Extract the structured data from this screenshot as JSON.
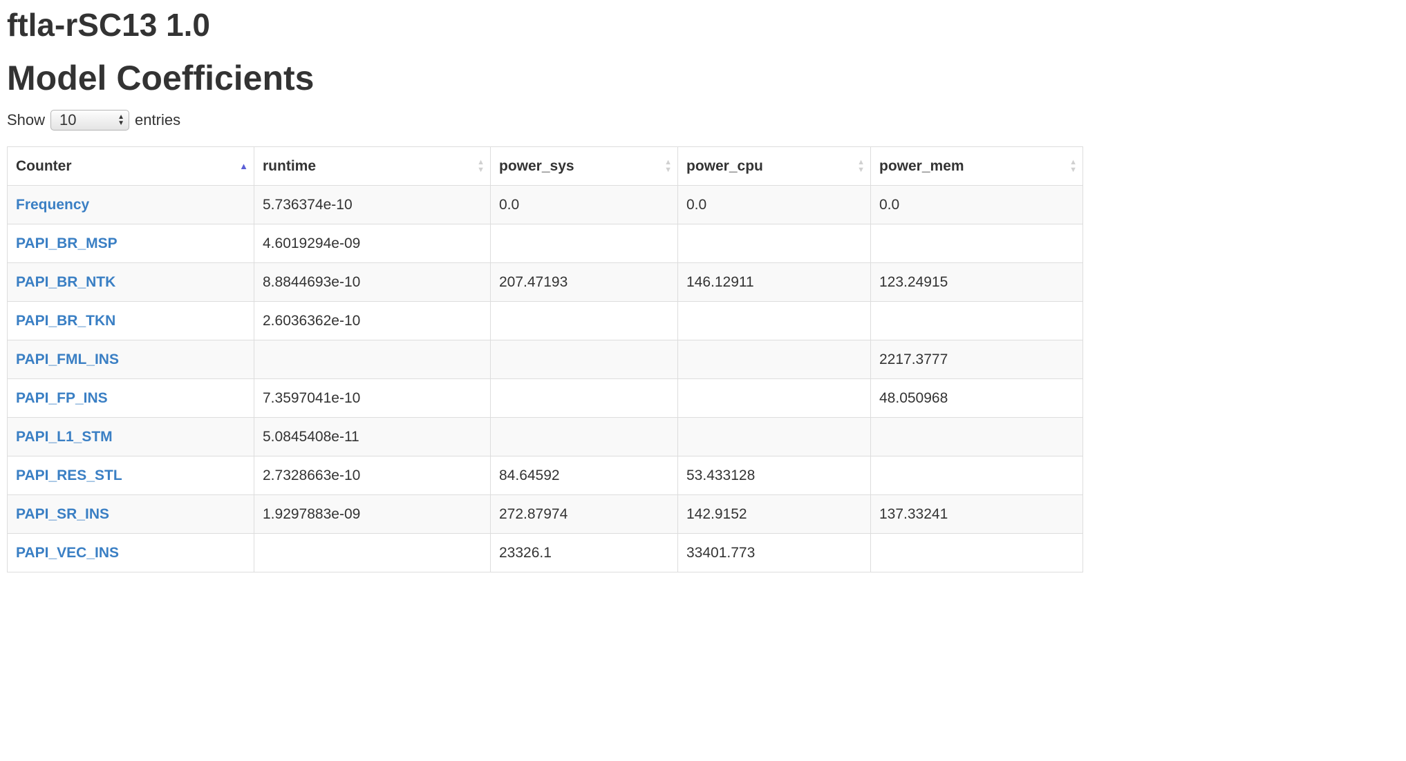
{
  "header": {
    "title": "ftla-rSC13 1.0",
    "subtitle": "Model Coefficients"
  },
  "length_menu": {
    "show_label": "Show",
    "selected": "10",
    "entries_label": "entries"
  },
  "table": {
    "columns": [
      "Counter",
      "runtime",
      "power_sys",
      "power_cpu",
      "power_mem"
    ],
    "rows": [
      [
        "Frequency",
        "5.736374e-10",
        "0.0",
        "0.0",
        "0.0"
      ],
      [
        "PAPI_BR_MSP",
        "4.6019294e-09",
        "",
        "",
        ""
      ],
      [
        "PAPI_BR_NTK",
        "8.8844693e-10",
        "207.47193",
        "146.12911",
        "123.24915"
      ],
      [
        "PAPI_BR_TKN",
        "2.6036362e-10",
        "",
        "",
        ""
      ],
      [
        "PAPI_FML_INS",
        "",
        "",
        "",
        "2217.3777"
      ],
      [
        "PAPI_FP_INS",
        "7.3597041e-10",
        "",
        "",
        "48.050968"
      ],
      [
        "PAPI_L1_STM",
        "5.0845408e-11",
        "",
        "",
        ""
      ],
      [
        "PAPI_RES_STL",
        "2.7328663e-10",
        "84.64592",
        "53.433128",
        ""
      ],
      [
        "PAPI_SR_INS",
        "1.9297883e-09",
        "272.87974",
        "142.9152",
        "137.33241"
      ],
      [
        "PAPI_VEC_INS",
        "",
        "23326.1",
        "33401.773",
        ""
      ]
    ]
  },
  "colors": {
    "link": "#3a7fc4",
    "sort_active": "#5b5fd6",
    "row_stripe": "#f9f9f9",
    "border": "#dddddd"
  }
}
